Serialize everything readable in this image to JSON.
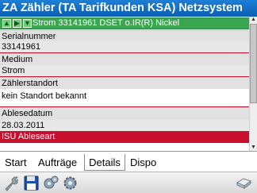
{
  "window": {
    "title": "ZA Zähler (TA Tarifkunden KSA) Netzsystem"
  },
  "nav": {
    "record_label": "Strom 33141961 DSET o.IR(R) Nickel",
    "icons": [
      "arrow-up-icon",
      "arrow-right-icon",
      "arrow-down-icon"
    ]
  },
  "fields": [
    {
      "label": "Serialnummer",
      "value": "33141961"
    },
    {
      "label": "Medium",
      "value": "Strom"
    },
    {
      "label": "Zählerstandort",
      "value": "kein Standort bekannt"
    },
    {
      "label": "Ablesedatum",
      "value": "28.03.2011"
    }
  ],
  "highlight_row": {
    "label": "ISU Ableseart"
  },
  "tabs": [
    {
      "label": "Start"
    },
    {
      "label": "Aufträge"
    },
    {
      "label": "Details"
    },
    {
      "label": "Dispo"
    }
  ],
  "active_tab": "Details",
  "toolbar": {
    "icons": [
      "wrench-icon",
      "save-icon",
      "gears-icon",
      "gear-icon",
      "keyboard-icon"
    ]
  },
  "colors": {
    "titlebar": "#0a5fb3",
    "nav_row": "#38a74f",
    "highlight": "#c8102e",
    "separator": "#c0152f"
  }
}
